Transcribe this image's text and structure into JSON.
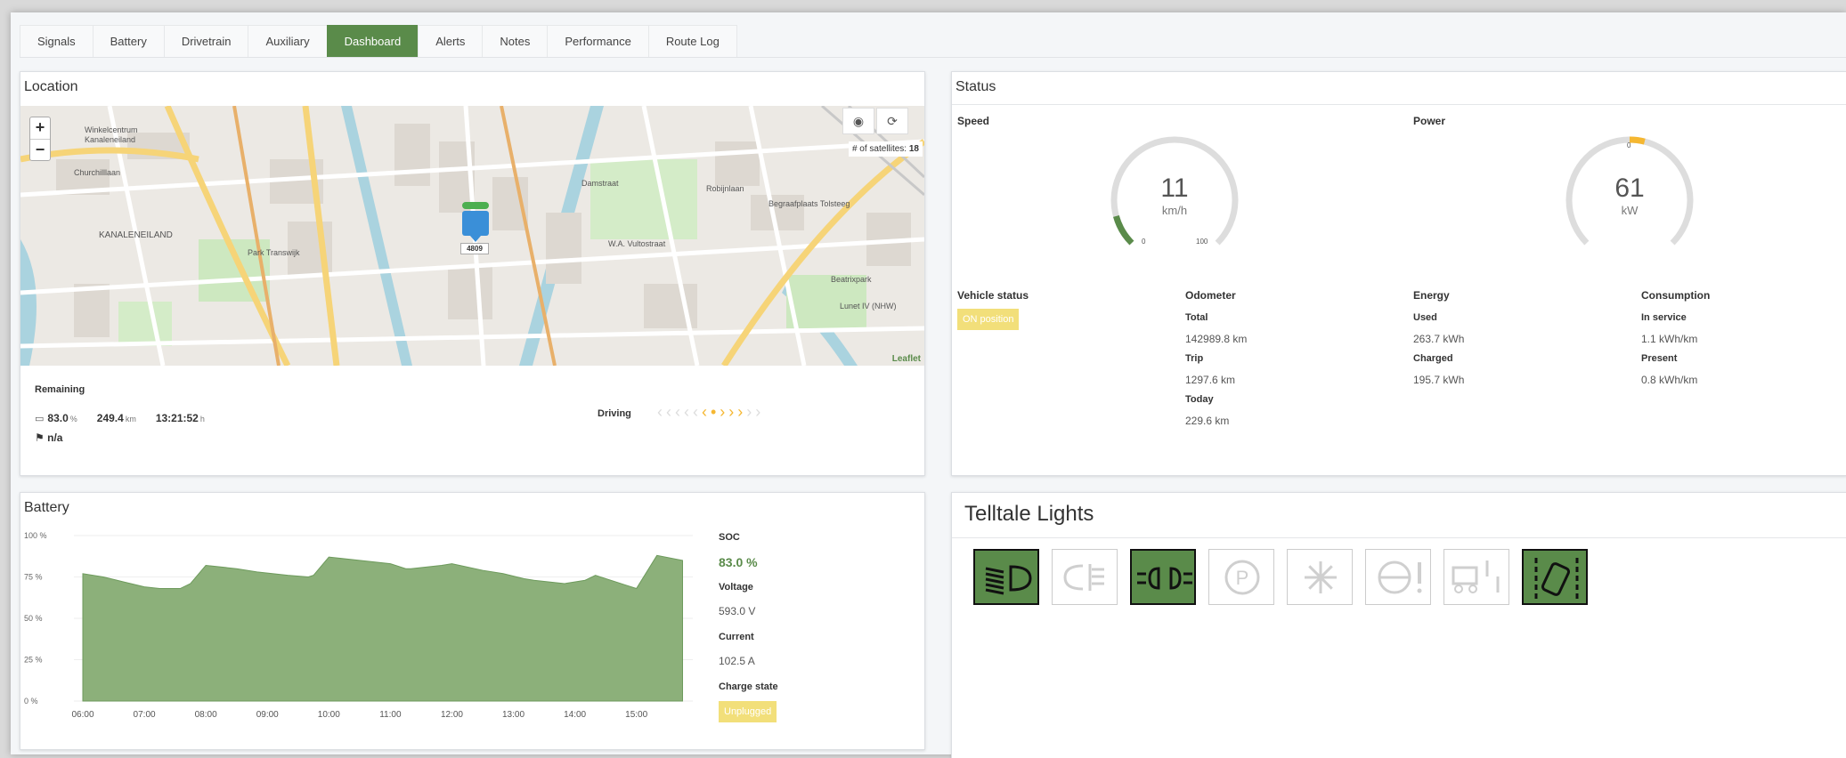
{
  "tabs": [
    "Signals",
    "Battery",
    "Drivetrain",
    "Auxiliary",
    "Dashboard",
    "Alerts",
    "Notes",
    "Performance",
    "Route Log"
  ],
  "active_tab": "Dashboard",
  "location": {
    "title": "Location",
    "zoom_in": "+",
    "zoom_out": "−",
    "satellites_label": "# of satellites:",
    "satellites": "18",
    "attribution": "Leaflet",
    "vehicle_id": "4809",
    "map_labels": [
      "Winkelcentrum",
      "Kanaleneiland",
      "KANALENEILAND",
      "Park Transwijk",
      "Churchilllaan",
      "Robijnlaan",
      "Begraafplaats Tolsteeg",
      "Beatrixpark",
      "Lunet IV (NHW)",
      "Damstraat",
      "W.A. Vultostraat"
    ],
    "remaining_label": "Remaining",
    "battery_pct": "83.0",
    "battery_pct_unit": "%",
    "range": "249.4",
    "range_unit": "km",
    "time": "13:21:52",
    "time_unit": "h",
    "destination": "n/a",
    "driving_label": "Driving"
  },
  "status": {
    "title": "Status",
    "speed_label": "Speed",
    "speed_value": "11",
    "speed_unit": "km/h",
    "speed_min": "0",
    "speed_max": "100",
    "speed_fraction": 0.11,
    "power_label": "Power",
    "power_value": "61",
    "power_unit": "kW",
    "power_zero": "0",
    "vehicle_status_label": "Vehicle status",
    "vehicle_status": "ON position",
    "odometer_label": "Odometer",
    "total_label": "Total",
    "total": "142989.8 km",
    "trip_label": "Trip",
    "trip": "1297.6 km",
    "today_label": "Today",
    "today": "229.6 km",
    "energy_label": "Energy",
    "used_label": "Used",
    "used": "263.7 kWh",
    "charged_label": "Charged",
    "charged": "195.7 kWh",
    "consumption_label": "Consumption",
    "in_service_label": "In service",
    "in_service": "1.1 kWh/km",
    "present_label": "Present",
    "present": "0.8 kWh/km"
  },
  "battery": {
    "title": "Battery",
    "soc_label": "SOC",
    "soc": "83.0 %",
    "voltage_label": "Voltage",
    "voltage": "593.0 V",
    "current_label": "Current",
    "current": "102.5 A",
    "charge_state_label": "Charge state",
    "charge_state": "Unplugged"
  },
  "chart_data": {
    "type": "area",
    "x": [
      "06:00",
      "06:20",
      "06:40",
      "07:00",
      "07:15",
      "07:35",
      "07:45",
      "08:00",
      "08:30",
      "08:50",
      "09:20",
      "09:40",
      "09:45",
      "10:00",
      "10:30",
      "11:00",
      "11:15",
      "11:20",
      "11:50",
      "12:00",
      "12:30",
      "12:50",
      "13:10",
      "13:20",
      "13:50",
      "14:10",
      "14:20",
      "14:50",
      "15:00",
      "15:20",
      "15:45"
    ],
    "values": [
      77,
      75,
      72,
      69,
      68,
      68,
      71,
      82,
      80,
      78,
      76,
      75,
      76,
      87,
      85,
      83,
      80,
      80,
      82,
      83,
      79,
      77,
      74,
      73,
      71,
      73,
      76,
      70,
      68,
      88,
      85
    ],
    "title": "",
    "xlabel": "",
    "ylabel": "",
    "xticks": [
      "06:00",
      "07:00",
      "08:00",
      "09:00",
      "10:00",
      "11:00",
      "12:00",
      "13:00",
      "14:00",
      "15:00"
    ],
    "yticks": [
      "0 %",
      "25 %",
      "50 %",
      "75 %",
      "100 %"
    ],
    "ylim": [
      0,
      100
    ],
    "color": "#8cb07a"
  },
  "telltale": {
    "title": "Telltale Lights",
    "lights": [
      {
        "name": "low-beam-icon",
        "on": true
      },
      {
        "name": "rear-fog-light-icon",
        "on": false
      },
      {
        "name": "position-lights-icon",
        "on": true
      },
      {
        "name": "parking-brake-icon",
        "on": false
      },
      {
        "name": "frost-warning-icon",
        "on": false
      },
      {
        "name": "steering-warning-icon",
        "on": false
      },
      {
        "name": "suspension-level-icon",
        "on": false
      },
      {
        "name": "lane-departure-icon",
        "on": true
      }
    ]
  },
  "colors": {
    "accent": "#5a8b4a",
    "warning": "#f2df7a",
    "gauge_track": "#dddddd",
    "gauge_orange": "#f5b731"
  }
}
